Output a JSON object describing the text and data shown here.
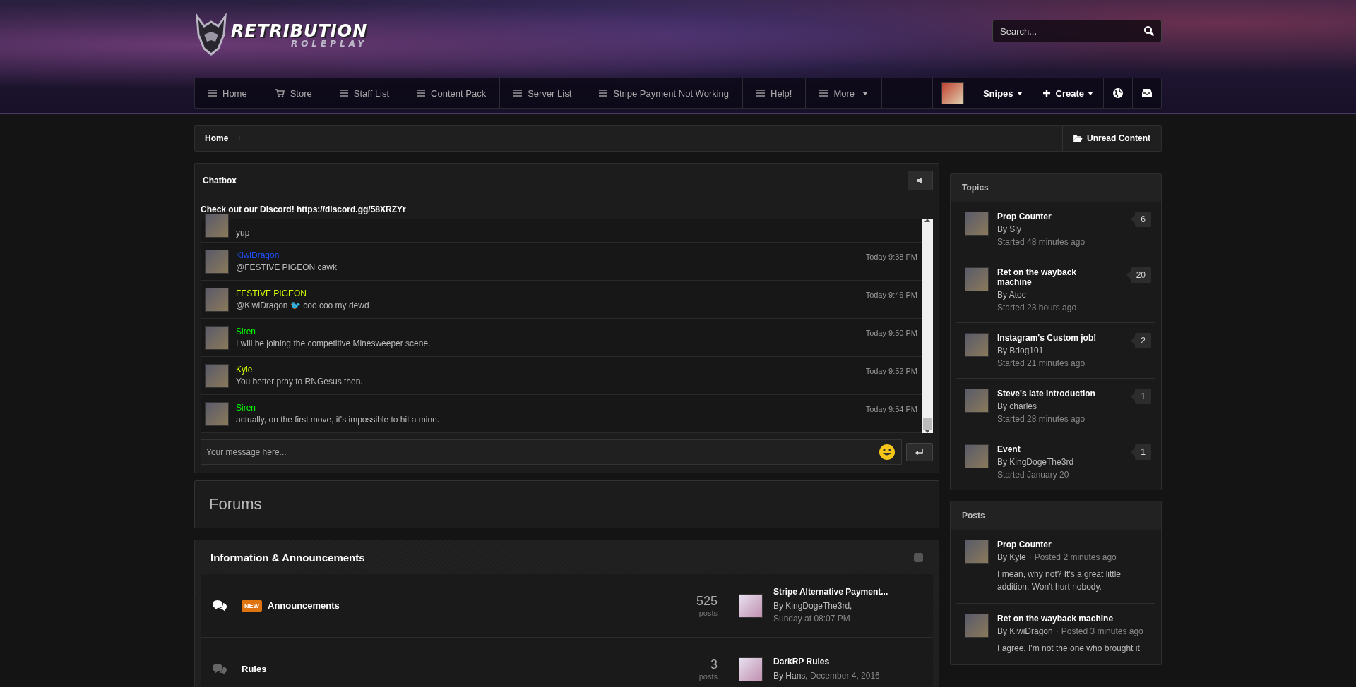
{
  "logo": {
    "title": "RETRIBUTION",
    "subtitle": "ROLEPLAY"
  },
  "search": {
    "placeholder": "Search..."
  },
  "nav": [
    {
      "label": "Home",
      "kind": "menu",
      "dropdown": false
    },
    {
      "label": "Store",
      "kind": "cart",
      "dropdown": false
    },
    {
      "label": "Staff List",
      "kind": "menu",
      "dropdown": false
    },
    {
      "label": "Content Pack",
      "kind": "menu",
      "dropdown": false
    },
    {
      "label": "Server List",
      "kind": "menu",
      "dropdown": false
    },
    {
      "label": "Stripe Payment Not Working",
      "kind": "menu",
      "dropdown": false
    },
    {
      "label": "Help!",
      "kind": "menu",
      "dropdown": false
    },
    {
      "label": "More",
      "kind": "menu",
      "dropdown": true
    }
  ],
  "user": {
    "name": "Snipes",
    "create": "Create"
  },
  "breadcrumb": {
    "items": [
      "Home"
    ],
    "unread": "Unread Content"
  },
  "chatbox": {
    "title": "Chatbox",
    "notice": "Check out our Discord! https://discord.gg/58XRZYr",
    "messages": [
      {
        "text": "yup"
      },
      {
        "user": "KiwiDragon",
        "color": "#1e50ff",
        "text": "@FESTIVE PIGEON cawk",
        "time": "Today 9:38 PM"
      },
      {
        "user": "FESTIVE PIGEON",
        "color": "#d4ff00",
        "text": "@KiwiDragon 🐦 coo coo my dewd",
        "time": "Today 9:46 PM"
      },
      {
        "user": "Siren",
        "color": "#00ff00",
        "text": "I will be joining the competitive Minesweeper scene.",
        "time": "Today 9:50 PM"
      },
      {
        "user": "Kyle",
        "color": "#d4ff00",
        "text": "You better pray to RNGesus then.",
        "time": "Today 9:52 PM"
      },
      {
        "user": "Siren",
        "color": "#00ff00",
        "text": "actually, on the first move, it's impossible to hit a mine.",
        "time": "Today 9:54 PM"
      }
    ],
    "placeholder": "Your message here..."
  },
  "forums": {
    "title": "Forums",
    "category": "Information & Announcements",
    "rows": [
      {
        "name": "Announcements",
        "unread": true,
        "badge": "NEW",
        "count": "525",
        "count_label": "posts",
        "last_title": "Stripe Alternative Payment...",
        "last_by": "By KingDogeThe3rd,",
        "last_date": "Sunday at 08:07 PM"
      },
      {
        "name": "Rules",
        "unread": false,
        "count": "3",
        "count_label": "posts",
        "last_title": "DarkRP Rules",
        "last_by": "By Hans,",
        "last_date": "December 4, 2016"
      }
    ]
  },
  "topics": {
    "title": "Topics",
    "items": [
      {
        "title": "Prop Counter",
        "author": "By Sly",
        "started": "Started 48 minutes ago",
        "count": "6"
      },
      {
        "title": "Ret on the wayback machine",
        "author": "By Atoc",
        "started": "Started 23 hours ago",
        "count": "20"
      },
      {
        "title": "Instagram's Custom job!",
        "author": "By Bdog101",
        "started": "Started 21 minutes ago",
        "count": "2"
      },
      {
        "title": "Steve's late introduction",
        "author": "By charles",
        "started": "Started 28 minutes ago",
        "count": "1"
      },
      {
        "title": "Event",
        "author": "By KingDogeThe3rd",
        "started": "Started January 20",
        "count": "1"
      }
    ]
  },
  "posts": {
    "title": "Posts",
    "items": [
      {
        "title": "Prop Counter",
        "author": "By Kyle",
        "separator": "·",
        "posted": "Posted 2 minutes ago",
        "excerpt": "I mean, why not? It's a great little addition. Won't hurt nobody."
      },
      {
        "title": "Ret on the wayback machine",
        "author": "By KiwiDragon",
        "separator": "·",
        "posted": "Posted 3 minutes ago",
        "excerpt": "I agree. I'm not the one who brought it"
      }
    ]
  }
}
